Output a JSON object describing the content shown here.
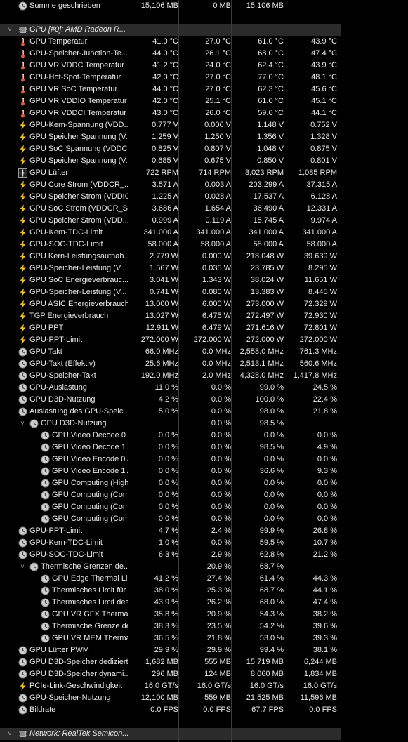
{
  "rows": [
    {
      "kind": "sensor",
      "icon": "circle",
      "indent": 0,
      "label": "Summe geschrieben",
      "v": [
        "15,106 MB",
        "0 MB",
        "15,106 MB",
        ""
      ]
    },
    {
      "kind": "blank"
    },
    {
      "kind": "header",
      "icon": "chip",
      "indent": 0,
      "label": "GPU [#0]: AMD Radeon R..."
    },
    {
      "kind": "sensor",
      "icon": "thermo",
      "indent": 0,
      "label": "GPU Temperatur",
      "v": [
        "41.0 °C",
        "27.0 °C",
        "61.0 °C",
        "43.9 °C"
      ]
    },
    {
      "kind": "sensor",
      "icon": "thermo",
      "indent": 0,
      "label": "GPU-Speicher-Junction-Te...",
      "v": [
        "44.0 °C",
        "26.1 °C",
        "68.0 °C",
        "47.4 °C"
      ]
    },
    {
      "kind": "sensor",
      "icon": "thermo",
      "indent": 0,
      "label": "GPU VR VDDC Temperatur",
      "v": [
        "41.2 °C",
        "24.0 °C",
        "62.4 °C",
        "43.9 °C"
      ]
    },
    {
      "kind": "sensor",
      "icon": "thermo",
      "indent": 0,
      "label": "GPU-Hot-Spot-Temperatur",
      "v": [
        "42.0 °C",
        "27.0 °C",
        "77.0 °C",
        "48.1 °C"
      ]
    },
    {
      "kind": "sensor",
      "icon": "thermo",
      "indent": 0,
      "label": "GPU VR SoC Temperatur",
      "v": [
        "44.0 °C",
        "27.0 °C",
        "62.3 °C",
        "45.6 °C"
      ]
    },
    {
      "kind": "sensor",
      "icon": "thermo",
      "indent": 0,
      "label": "GPU VR VDDIO Temperatur",
      "v": [
        "42.0 °C",
        "25.1 °C",
        "61.0 °C",
        "45.1 °C"
      ]
    },
    {
      "kind": "sensor",
      "icon": "thermo",
      "indent": 0,
      "label": "GPU VR VDDCI Temperatur",
      "v": [
        "43.0 °C",
        "26.0 °C",
        "59.0 °C",
        "44.1 °C"
      ]
    },
    {
      "kind": "sensor",
      "icon": "bolt",
      "indent": 0,
      "label": "GPU-Kern-Spannung (VDD...",
      "v": [
        "0.777 V",
        "0.006 V",
        "1.148 V",
        "0.752 V"
      ]
    },
    {
      "kind": "sensor",
      "icon": "bolt",
      "indent": 0,
      "label": "GPU Speicher Spannung (V...",
      "v": [
        "1.259 V",
        "1.250 V",
        "1.356 V",
        "1.328 V"
      ]
    },
    {
      "kind": "sensor",
      "icon": "bolt",
      "indent": 0,
      "label": "GPU SoC Spannung (VDDC...",
      "v": [
        "0.825 V",
        "0.807 V",
        "1.048 V",
        "0.875 V"
      ]
    },
    {
      "kind": "sensor",
      "icon": "bolt",
      "indent": 0,
      "label": "GPU Speicher Spannung (V...",
      "v": [
        "0.685 V",
        "0.675 V",
        "0.850 V",
        "0.801 V"
      ]
    },
    {
      "kind": "sensor",
      "icon": "fan",
      "indent": 0,
      "label": "GPU Lüfter",
      "v": [
        "722 RPM",
        "714 RPM",
        "3,023 RPM",
        "1,085 RPM"
      ]
    },
    {
      "kind": "sensor",
      "icon": "bolt",
      "indent": 0,
      "label": "GPU Core Strom (VDDCR_...",
      "v": [
        "3.571 A",
        "0.003 A",
        "203.299 A",
        "37.315 A"
      ]
    },
    {
      "kind": "sensor",
      "icon": "bolt",
      "indent": 0,
      "label": "GPU Speicher Strom (VDDIO)",
      "v": [
        "1.225 A",
        "0.028 A",
        "17.537 A",
        "6.128 A"
      ]
    },
    {
      "kind": "sensor",
      "icon": "bolt",
      "indent": 0,
      "label": "GPU SoC Strom (VDDCR_S...",
      "v": [
        "3.686 A",
        "1.654 A",
        "36.490 A",
        "12.331 A"
      ]
    },
    {
      "kind": "sensor",
      "icon": "bolt",
      "indent": 0,
      "label": "GPU Speicher Strom (VDD...",
      "v": [
        "0.999 A",
        "0.119 A",
        "15.745 A",
        "9.974 A"
      ]
    },
    {
      "kind": "sensor",
      "icon": "bolt",
      "indent": 0,
      "label": "GPU-Kern-TDC-Limit",
      "v": [
        "341.000 A",
        "341.000 A",
        "341.000 A",
        "341.000 A"
      ]
    },
    {
      "kind": "sensor",
      "icon": "bolt",
      "indent": 0,
      "label": "GPU-SOC-TDC-Limit",
      "v": [
        "58.000 A",
        "58.000 A",
        "58.000 A",
        "58.000 A"
      ]
    },
    {
      "kind": "sensor",
      "icon": "bolt",
      "indent": 0,
      "label": "GPU Kern-Leistungsaufnah...",
      "v": [
        "2.779 W",
        "0.000 W",
        "218.048 W",
        "39.639 W"
      ]
    },
    {
      "kind": "sensor",
      "icon": "bolt",
      "indent": 0,
      "label": "GPU-Speicher-Leistung (V...",
      "v": [
        "1.567 W",
        "0.035 W",
        "23.785 W",
        "8.295 W"
      ]
    },
    {
      "kind": "sensor",
      "icon": "bolt",
      "indent": 0,
      "label": "GPU SoC Energieverbrauc...",
      "v": [
        "3.041 W",
        "1.343 W",
        "38.024 W",
        "11.651 W"
      ]
    },
    {
      "kind": "sensor",
      "icon": "bolt",
      "indent": 0,
      "label": "GPU-Speicher-Leistung (V...",
      "v": [
        "0.741 W",
        "0.080 W",
        "13.383 W",
        "8.445 W"
      ]
    },
    {
      "kind": "sensor",
      "icon": "bolt",
      "indent": 0,
      "label": "GPU ASIC Energieverbrauch",
      "v": [
        "13.000 W",
        "6.000 W",
        "273.000 W",
        "72.329 W"
      ]
    },
    {
      "kind": "sensor",
      "icon": "bolt",
      "indent": 0,
      "label": "TGP Energieverbrauch",
      "v": [
        "13.027 W",
        "6.475 W",
        "272.497 W",
        "72.930 W"
      ]
    },
    {
      "kind": "sensor",
      "icon": "bolt",
      "indent": 0,
      "label": "GPU PPT",
      "v": [
        "12.911 W",
        "6.479 W",
        "271.616 W",
        "72.801 W"
      ]
    },
    {
      "kind": "sensor",
      "icon": "bolt",
      "indent": 0,
      "label": "GPU-PPT-Limit",
      "v": [
        "272.000 W",
        "272.000 W",
        "272.000 W",
        "272.000 W"
      ]
    },
    {
      "kind": "sensor",
      "icon": "circle",
      "indent": 0,
      "label": "GPU Takt",
      "v": [
        "66.0 MHz",
        "0.0 MHz",
        "2,558.0 MHz",
        "761.3 MHz"
      ]
    },
    {
      "kind": "sensor",
      "icon": "circle",
      "indent": 0,
      "label": "GPU-Takt (Effektiv)",
      "v": [
        "25.6 MHz",
        "0.0 MHz",
        "2,513.1 MHz",
        "560.6 MHz"
      ]
    },
    {
      "kind": "sensor",
      "icon": "circle",
      "indent": 0,
      "label": "GPU-Speicher-Takt",
      "v": [
        "192.0 MHz",
        "2.0 MHz",
        "4,328.0 MHz",
        "1,417.8 MHz"
      ]
    },
    {
      "kind": "sensor",
      "icon": "circle",
      "indent": 0,
      "label": "GPU-Auslastung",
      "v": [
        "11.0 %",
        "0.0 %",
        "99.0 %",
        "24.5 %"
      ]
    },
    {
      "kind": "sensor",
      "icon": "circle",
      "indent": 0,
      "label": "GPU D3D-Nutzung",
      "v": [
        "4.2 %",
        "0.0 %",
        "100.0 %",
        "22.4 %"
      ]
    },
    {
      "kind": "sensor",
      "icon": "circle",
      "indent": 0,
      "expand": "collapse",
      "label": "Auslastung des GPU-Speic...",
      "v": [
        "5.0 %",
        "0.0 %",
        "98.0 %",
        "21.8 %"
      ]
    },
    {
      "kind": "sensor",
      "icon": "circle",
      "indent": 1,
      "expand": "open",
      "label": "GPU D3D-Nutzung",
      "v": [
        "",
        "0.0 %",
        "98.5 %",
        ""
      ]
    },
    {
      "kind": "sensor",
      "icon": "circle",
      "indent": 2,
      "label": "GPU Video Decode 0 A...",
      "v": [
        "0.0 %",
        "0.0 %",
        "0.0 %",
        "0.0 %"
      ]
    },
    {
      "kind": "sensor",
      "icon": "circle",
      "indent": 2,
      "label": "GPU Video Decode 1 A...",
      "v": [
        "0.0 %",
        "0.0 %",
        "98.5 %",
        "4.9 %"
      ]
    },
    {
      "kind": "sensor",
      "icon": "circle",
      "indent": 2,
      "label": "GPU Video Encode 0 Au...",
      "v": [
        "0.0 %",
        "0.0 %",
        "0.0 %",
        "0.0 %"
      ]
    },
    {
      "kind": "sensor",
      "icon": "circle",
      "indent": 2,
      "label": "GPU Video Encode 1 Au...",
      "v": [
        "0.0 %",
        "0.0 %",
        "36.6 %",
        "9.3 %"
      ]
    },
    {
      "kind": "sensor",
      "icon": "circle",
      "indent": 2,
      "label": "GPU Computing (High P...",
      "v": [
        "0.0 %",
        "0.0 %",
        "0.0 %",
        "0.0 %"
      ]
    },
    {
      "kind": "sensor",
      "icon": "circle",
      "indent": 2,
      "label": "GPU Computing (Comp...",
      "v": [
        "0.0 %",
        "0.0 %",
        "0.0 %",
        "0.0 %"
      ]
    },
    {
      "kind": "sensor",
      "icon": "circle",
      "indent": 2,
      "label": "GPU Computing (Comp...",
      "v": [
        "0.0 %",
        "0.0 %",
        "0.0 %",
        "0.0 %"
      ]
    },
    {
      "kind": "sensor",
      "icon": "circle",
      "indent": 2,
      "label": "GPU Computing (Comp...",
      "v": [
        "0.0 %",
        "0.0 %",
        "0.0 %",
        "0.0 %"
      ]
    },
    {
      "kind": "sensor",
      "icon": "circle",
      "indent": 0,
      "label": "GPU-PPT-Limit",
      "v": [
        "4.7 %",
        "2.4 %",
        "99.9 %",
        "26.8 %"
      ]
    },
    {
      "kind": "sensor",
      "icon": "circle",
      "indent": 0,
      "label": "GPU-Kern-TDC-Limit",
      "v": [
        "1.0 %",
        "0.0 %",
        "59.5 %",
        "10.7 %"
      ]
    },
    {
      "kind": "sensor",
      "icon": "circle",
      "indent": 0,
      "label": "GPU-SOC-TDC-Limit",
      "v": [
        "6.3 %",
        "2.9 %",
        "62.8 %",
        "21.2 %"
      ]
    },
    {
      "kind": "sensor",
      "icon": "circle",
      "indent": 1,
      "expand": "open",
      "label": "Thermische Grenzen de...",
      "v": [
        "",
        "20.9 %",
        "68.7 %",
        ""
      ]
    },
    {
      "kind": "sensor",
      "icon": "circle",
      "indent": 2,
      "label": "GPU Edge Thermal Limit",
      "v": [
        "41.2 %",
        "27.4 %",
        "61.4 %",
        "44.3 %"
      ]
    },
    {
      "kind": "sensor",
      "icon": "circle",
      "indent": 2,
      "label": "Thermisches Limit für G...",
      "v": [
        "38.0 %",
        "25.3 %",
        "68.7 %",
        "44.1 %"
      ]
    },
    {
      "kind": "sensor",
      "icon": "circle",
      "indent": 2,
      "label": "Thermisches Limit des ...",
      "v": [
        "43.9 %",
        "26.2 %",
        "68.0 %",
        "47.4 %"
      ]
    },
    {
      "kind": "sensor",
      "icon": "circle",
      "indent": 2,
      "label": "GPU VR GFX Thermal Limit",
      "v": [
        "35.8 %",
        "20.9 %",
        "54.3 %",
        "38.2 %"
      ]
    },
    {
      "kind": "sensor",
      "icon": "circle",
      "indent": 2,
      "label": "Thermische Grenze des ...",
      "v": [
        "38.3 %",
        "23.5 %",
        "54.2 %",
        "39.6 %"
      ]
    },
    {
      "kind": "sensor",
      "icon": "circle",
      "indent": 2,
      "label": "GPU VR MEM Thermal Li...",
      "v": [
        "36.5 %",
        "21.8 %",
        "53.0 %",
        "39.3 %"
      ]
    },
    {
      "kind": "sensor",
      "icon": "circle",
      "indent": 0,
      "label": "GPU Lüfter PWM",
      "v": [
        "29.9 %",
        "29.9 %",
        "99.4 %",
        "38.1 %"
      ]
    },
    {
      "kind": "sensor",
      "icon": "circle",
      "indent": 0,
      "label": "GPU D3D-Speicher dediziert",
      "v": [
        "1,682 MB",
        "555 MB",
        "15,719 MB",
        "6,244 MB"
      ]
    },
    {
      "kind": "sensor",
      "icon": "circle",
      "indent": 0,
      "label": "GPU D3D-Speicher dynami...",
      "v": [
        "296 MB",
        "124 MB",
        "8,060 MB",
        "1,834 MB"
      ]
    },
    {
      "kind": "sensor",
      "icon": "bolt",
      "indent": 0,
      "label": "PCIe-Link-Geschwindigkeit",
      "v": [
        "16.0 GT/s",
        "16.0 GT/s",
        "16.0 GT/s",
        "16.0 GT/s"
      ]
    },
    {
      "kind": "sensor",
      "icon": "circle",
      "indent": 0,
      "label": "GPU-Speicher-Nutzung",
      "v": [
        "12,100 MB",
        "559 MB",
        "21,525 MB",
        "11,596 MB"
      ]
    },
    {
      "kind": "sensor",
      "icon": "circle",
      "indent": 0,
      "label": "Bildrate",
      "v": [
        "0.0 FPS",
        "0.0 FPS",
        "67.7 FPS",
        "0.0 FPS"
      ]
    },
    {
      "kind": "blank"
    },
    {
      "kind": "header",
      "icon": "chip",
      "indent": 0,
      "label": "Network: RealTek Semicon..."
    }
  ],
  "colors": {
    "background": "#000000",
    "header_bg": "#2b2b2b",
    "text": "#e8e8e8",
    "bolt": "#f2c31a",
    "thermo": "#e05a3a"
  }
}
